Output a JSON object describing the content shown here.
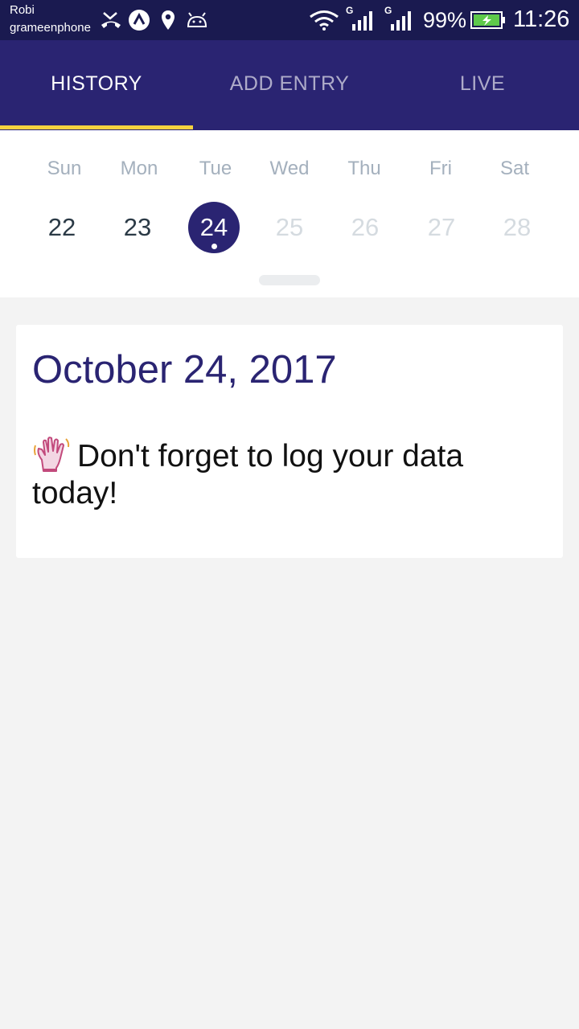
{
  "status_bar": {
    "carrier_line1": "Robi",
    "carrier_line2": "grameenphone",
    "network_label_1": "G",
    "network_label_2": "G",
    "battery_percent": "99%",
    "time": "11:26",
    "icons": [
      "missed-call-icon",
      "app-notification-icon",
      "location-icon",
      "android-icon",
      "wifi-icon",
      "signal-icon",
      "signal-icon",
      "battery-charging-icon"
    ]
  },
  "tabs": {
    "items": [
      {
        "label": "HISTORY"
      },
      {
        "label": "ADD ENTRY"
      },
      {
        "label": "LIVE"
      }
    ],
    "active_index": 0
  },
  "week": {
    "days": [
      "Sun",
      "Mon",
      "Tue",
      "Wed",
      "Thu",
      "Fri",
      "Sat"
    ],
    "dates": [
      "22",
      "23",
      "24",
      "25",
      "26",
      "27",
      "28"
    ],
    "selected_index": 2
  },
  "card": {
    "date": "October 24, 2017",
    "message": "Don't forget to log your data today!",
    "icon": "waving-hand-icon"
  },
  "colors": {
    "status_bar": "#1a1a50",
    "primary": "#2a2472",
    "tab_indicator": "#f5d33f",
    "background": "#f3f3f3"
  }
}
